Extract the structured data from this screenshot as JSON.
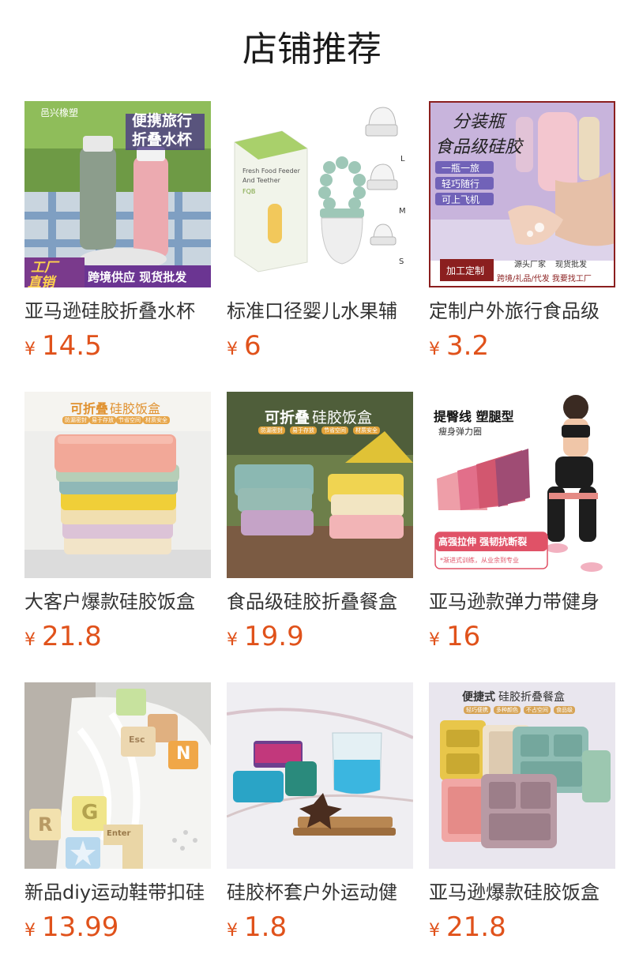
{
  "page_title": "店铺推荐",
  "currency_symbol": "¥",
  "products": [
    {
      "name": "亚马逊硅胶折叠水杯",
      "price": "14.5",
      "image": {
        "brand": "邑兴橡塑",
        "line1": "便携旅行",
        "line2": "折叠水杯",
        "badge_a": "工厂",
        "badge_b": "直销",
        "banner": "跨境供应 现货批发"
      }
    },
    {
      "name": "标准口径婴儿水果辅",
      "price": "6",
      "image": {
        "box_line1": "Fresh Food Feeder",
        "box_line2": "And Teether",
        "box_brand": "FQB",
        "size_l": "L",
        "size_m": "M",
        "size_s": "S"
      }
    },
    {
      "name": "定制户外旅行食品级",
      "price": "3.2",
      "image": {
        "line1": "分装瓶",
        "line2": "食品级硅胶",
        "tag1": "一瓶一旅",
        "tag2": "轻巧随行",
        "tag3": "可上飞机",
        "custom": "加工定制",
        "factory": "源头厂家",
        "sale": "现货批发",
        "bottom": "跨境/礼品/代发 我要找工厂"
      }
    },
    {
      "name": "大客户爆款硅胶饭盒",
      "price": "21.8",
      "image": {
        "title_bold": "可折叠",
        "title_rest": "硅胶饭盒",
        "tags": [
          "防漏密封",
          "易于存放",
          "节省空间",
          "材质安全"
        ]
      }
    },
    {
      "name": "食品级硅胶折叠餐盒",
      "price": "19.9",
      "image": {
        "title_bold": "可折叠",
        "title_rest": "硅胶饭盒",
        "tags": [
          "防漏密封",
          "易于存放",
          "节省空间",
          "材质安全"
        ]
      }
    },
    {
      "name": "亚马逊款弹力带健身",
      "price": "16",
      "image": {
        "line1": "提臀线 塑腿型",
        "line2": "瘦身弹力圈",
        "banner": "高强拉伸 强韧抗断裂",
        "note": "*渐进式训练，从业余到专业"
      }
    },
    {
      "name": "新品diy运动鞋带扣硅",
      "price": "13.99",
      "image": {
        "charm_r": "R",
        "charm_g": "G",
        "charm_enter": "Enter",
        "charm_esc": "Esc",
        "charm_n": "N"
      }
    },
    {
      "name": "硅胶杯套户外运动健",
      "price": "1.8",
      "image": {}
    },
    {
      "name": "亚马逊爆款硅胶饭盒",
      "price": "21.8",
      "image": {
        "title_bold": "便捷式",
        "title_rest": "硅胶折叠餐盒",
        "tags": [
          "轻巧便携",
          "多种颜色",
          "不占空间",
          "食品级"
        ]
      }
    }
  ],
  "colors": {
    "price": "#e0521b",
    "title": "#1a1a1a",
    "name": "#333333"
  }
}
